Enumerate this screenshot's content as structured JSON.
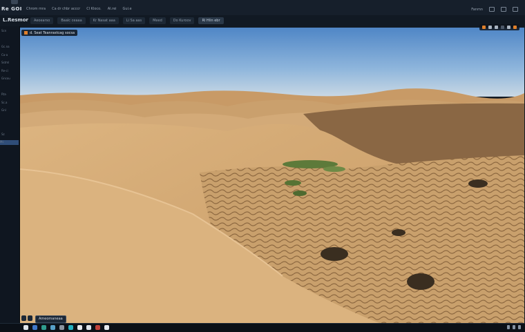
{
  "app": {
    "title": "Re GOI"
  },
  "menu": [
    "Chrom mra",
    "Ca dr chbr acccr",
    "Cl Kloco.",
    "Al.rei",
    "Gui.e"
  ],
  "window_controls": {
    "account": "Fanmn",
    "items": [
      "min",
      "max",
      "close"
    ]
  },
  "toolbar": {
    "title": "L.Resmor",
    "tabs": [
      "Aeoearso",
      "Baalc ceaaa",
      "Kr Nasat aaa",
      "Li Sa aas",
      "Meed",
      "Do Kuroov",
      "Rl Hlin ebr"
    ]
  },
  "sidebar": {
    "items": [
      "Scn",
      "",
      "Gc.na",
      "Ca-a",
      "Sstml",
      "Re-ci",
      "Gncou",
      "",
      "Rta",
      "Sc.a",
      "Gnl",
      "",
      "",
      "Sz",
      "Mc"
    ],
    "active_index": 14
  },
  "viewer": {
    "breadcrumb": "d. Seat Teanrastcag socsa",
    "image_label": "desert sand dunes landscape"
  },
  "viewer_tools": [
    "orange",
    "light",
    "light",
    "dark",
    "light",
    "orange"
  ],
  "taskbar": {
    "label": "Ameomaneaa",
    "icon_colors": [
      "#dfe5ec",
      "#3f77c8",
      "#2f9c8e",
      "#57a0c8",
      "#8a949f",
      "#24b0c0",
      "#e6e9ee",
      "#dfe5ec",
      "#c1423b",
      "#e6e9ee"
    ]
  }
}
